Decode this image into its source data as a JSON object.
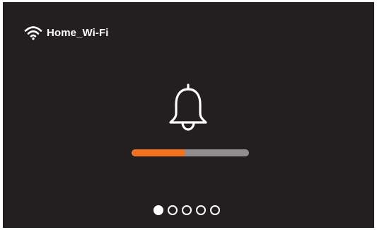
{
  "status": {
    "network_name": "Home_Wi-Fi",
    "network_icon": "wifi-icon"
  },
  "main": {
    "icon": "bell-icon",
    "progress": 0.45,
    "progress_fill_color": "#f37021",
    "progress_track_color": "#8e8e8e"
  },
  "pagination": {
    "total": 5,
    "active_index": 0
  },
  "colors": {
    "background": "#231f20",
    "foreground": "#ffffff"
  }
}
